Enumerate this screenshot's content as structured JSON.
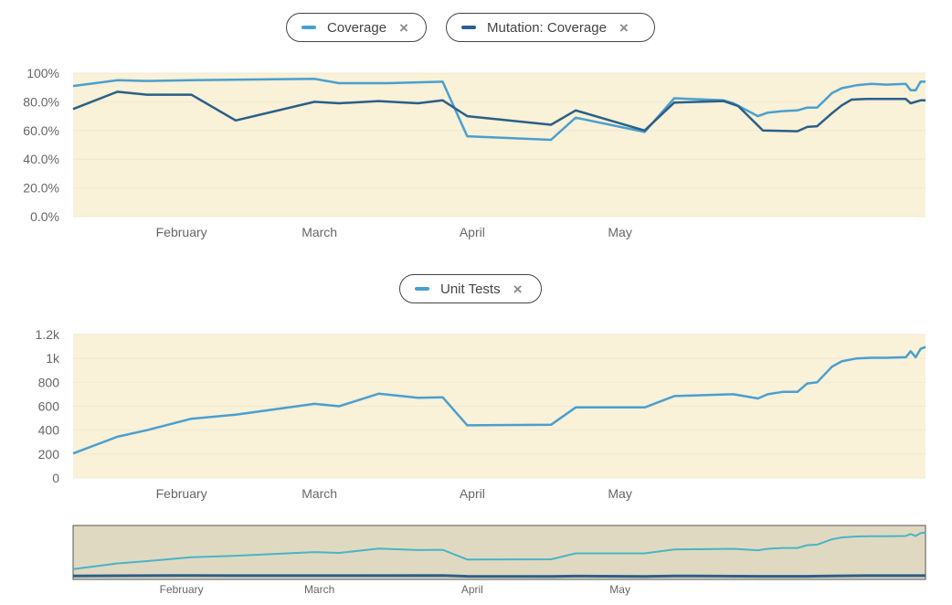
{
  "colors": {
    "plot_bg": "#f9f1d8",
    "navigator_bg": "#e0d9c2",
    "coverage": "#4a9fd0",
    "mutation": "#2b5f87",
    "unit_tests": "#4a9fd0",
    "navigator_line": "#4ab4c4",
    "grid": "#f0e8d3",
    "text": "#666666"
  },
  "legends": {
    "coverage": {
      "label": "Coverage",
      "close_icon": "×"
    },
    "mutation": {
      "label": "Mutation: Coverage",
      "close_icon": "×"
    },
    "unit_tests": {
      "label": "Unit Tests",
      "close_icon": "×"
    }
  },
  "chart_data": [
    {
      "type": "line",
      "x_ticks": [
        "February",
        "March",
        "April",
        "May"
      ],
      "y_ticks": [
        "0.0%",
        "20.0%",
        "40.0%",
        "60.0%",
        "80.0%",
        "100%"
      ],
      "ylim": [
        0,
        100
      ],
      "grid": true,
      "legend_position": "top-center",
      "series": [
        {
          "name": "Coverage",
          "points": [
            [
              "2025-01-10",
              91
            ],
            [
              "2025-01-19",
              95
            ],
            [
              "2025-01-25",
              94.5
            ],
            [
              "2025-02-03",
              95
            ],
            [
              "2025-02-28",
              96
            ],
            [
              "2025-03-05",
              93
            ],
            [
              "2025-03-15",
              93
            ],
            [
              "2025-03-26",
              94
            ],
            [
              "2025-03-31",
              56
            ],
            [
              "2025-04-17",
              53.5
            ],
            [
              "2025-04-22",
              69
            ],
            [
              "2025-05-06",
              59
            ],
            [
              "2025-05-12",
              82.5
            ],
            [
              "2025-05-22",
              81
            ],
            [
              "2025-05-24",
              79
            ],
            [
              "2025-05-29",
              70
            ],
            [
              "2025-05-31",
              72.5
            ],
            [
              "2025-06-03",
              73.5
            ],
            [
              "2025-06-06",
              74
            ],
            [
              "2025-06-08",
              76
            ],
            [
              "2025-06-10",
              76
            ],
            [
              "2025-06-13",
              86
            ],
            [
              "2025-06-15",
              89.5
            ],
            [
              "2025-06-18",
              91.5
            ],
            [
              "2025-06-21",
              92.5
            ],
            [
              "2025-06-24",
              92
            ],
            [
              "2025-06-28",
              92.5
            ],
            [
              "2025-06-29",
              88
            ],
            [
              "2025-06-30",
              88
            ],
            [
              "2025-07-01",
              94
            ],
            [
              "2025-07-02",
              94
            ]
          ]
        },
        {
          "name": "Mutation: Coverage",
          "points": [
            [
              "2025-01-10",
              75
            ],
            [
              "2025-01-19",
              87
            ],
            [
              "2025-01-25",
              85
            ],
            [
              "2025-02-03",
              85
            ],
            [
              "2025-02-12",
              67
            ],
            [
              "2025-02-28",
              80
            ],
            [
              "2025-03-05",
              79
            ],
            [
              "2025-03-13",
              80.5
            ],
            [
              "2025-03-21",
              79
            ],
            [
              "2025-03-26",
              81
            ],
            [
              "2025-03-31",
              70
            ],
            [
              "2025-04-17",
              64
            ],
            [
              "2025-04-22",
              74
            ],
            [
              "2025-05-06",
              60
            ],
            [
              "2025-05-12",
              79.5
            ],
            [
              "2025-05-22",
              80.5
            ],
            [
              "2025-05-25",
              77
            ],
            [
              "2025-05-30",
              60
            ],
            [
              "2025-06-06",
              59.5
            ],
            [
              "2025-06-08",
              62.5
            ],
            [
              "2025-06-10",
              63
            ],
            [
              "2025-06-13",
              72
            ],
            [
              "2025-06-15",
              77.5
            ],
            [
              "2025-06-17",
              81.5
            ],
            [
              "2025-06-20",
              82
            ],
            [
              "2025-06-28",
              82
            ],
            [
              "2025-06-29",
              79
            ],
            [
              "2025-07-01",
              81
            ],
            [
              "2025-07-02",
              81
            ]
          ]
        }
      ]
    },
    {
      "type": "line",
      "x_ticks": [
        "February",
        "March",
        "April",
        "May"
      ],
      "y_ticks": [
        "0",
        "200",
        "400",
        "600",
        "800",
        "1k",
        "1.2k"
      ],
      "ylim": [
        0,
        1200
      ],
      "grid": true,
      "legend_position": "top-center",
      "series": [
        {
          "name": "Unit Tests",
          "points": [
            [
              "2025-01-10",
              205
            ],
            [
              "2025-01-19",
              345
            ],
            [
              "2025-01-25",
              400
            ],
            [
              "2025-02-03",
              495
            ],
            [
              "2025-02-12",
              530
            ],
            [
              "2025-02-28",
              620
            ],
            [
              "2025-03-05",
              600
            ],
            [
              "2025-03-13",
              705
            ],
            [
              "2025-03-21",
              670
            ],
            [
              "2025-03-26",
              675
            ],
            [
              "2025-03-31",
              440
            ],
            [
              "2025-04-17",
              445
            ],
            [
              "2025-04-22",
              590
            ],
            [
              "2025-05-06",
              590
            ],
            [
              "2025-05-12",
              685
            ],
            [
              "2025-05-24",
              700
            ],
            [
              "2025-05-29",
              665
            ],
            [
              "2025-05-31",
              700
            ],
            [
              "2025-06-03",
              720
            ],
            [
              "2025-06-06",
              720
            ],
            [
              "2025-06-08",
              790
            ],
            [
              "2025-06-10",
              800
            ],
            [
              "2025-06-13",
              930
            ],
            [
              "2025-06-15",
              975
            ],
            [
              "2025-06-18",
              1000
            ],
            [
              "2025-06-21",
              1005
            ],
            [
              "2025-06-24",
              1005
            ],
            [
              "2025-06-28",
              1010
            ],
            [
              "2025-06-29",
              1060
            ],
            [
              "2025-06-30",
              1010
            ],
            [
              "2025-07-01",
              1080
            ],
            [
              "2025-07-02",
              1095
            ]
          ]
        }
      ]
    },
    {
      "type": "area",
      "x_ticks": [
        "February",
        "March",
        "April",
        "May"
      ],
      "series": [
        {
          "points": [
            [
              "2025-01-10",
              205
            ],
            [
              "2025-01-19",
              345
            ],
            [
              "2025-01-25",
              400
            ],
            [
              "2025-02-03",
              495
            ],
            [
              "2025-02-12",
              530
            ],
            [
              "2025-02-28",
              620
            ],
            [
              "2025-03-05",
              600
            ],
            [
              "2025-03-13",
              705
            ],
            [
              "2025-03-21",
              670
            ],
            [
              "2025-03-26",
              675
            ],
            [
              "2025-03-31",
              440
            ],
            [
              "2025-04-17",
              445
            ],
            [
              "2025-04-22",
              590
            ],
            [
              "2025-05-06",
              590
            ],
            [
              "2025-05-12",
              685
            ],
            [
              "2025-05-24",
              700
            ],
            [
              "2025-05-29",
              665
            ],
            [
              "2025-05-31",
              700
            ],
            [
              "2025-06-03",
              720
            ],
            [
              "2025-06-06",
              720
            ],
            [
              "2025-06-08",
              790
            ],
            [
              "2025-06-10",
              800
            ],
            [
              "2025-06-13",
              930
            ],
            [
              "2025-06-15",
              975
            ],
            [
              "2025-06-18",
              1000
            ],
            [
              "2025-06-21",
              1005
            ],
            [
              "2025-06-24",
              1005
            ],
            [
              "2025-06-28",
              1010
            ],
            [
              "2025-06-29",
              1060
            ],
            [
              "2025-06-30",
              1010
            ],
            [
              "2025-07-01",
              1080
            ],
            [
              "2025-07-02",
              1095
            ]
          ]
        },
        {
          "points": [
            [
              "2025-01-10",
              40
            ],
            [
              "2025-02-01",
              48
            ],
            [
              "2025-03-01",
              47
            ],
            [
              "2025-03-26",
              48
            ],
            [
              "2025-03-31",
              30
            ],
            [
              "2025-04-17",
              28
            ],
            [
              "2025-04-22",
              36
            ],
            [
              "2025-05-06",
              28
            ],
            [
              "2025-05-12",
              40
            ],
            [
              "2025-05-29",
              32
            ],
            [
              "2025-06-08",
              30
            ],
            [
              "2025-06-15",
              42
            ],
            [
              "2025-06-20",
              46
            ],
            [
              "2025-07-02",
              46
            ]
          ]
        }
      ]
    }
  ]
}
